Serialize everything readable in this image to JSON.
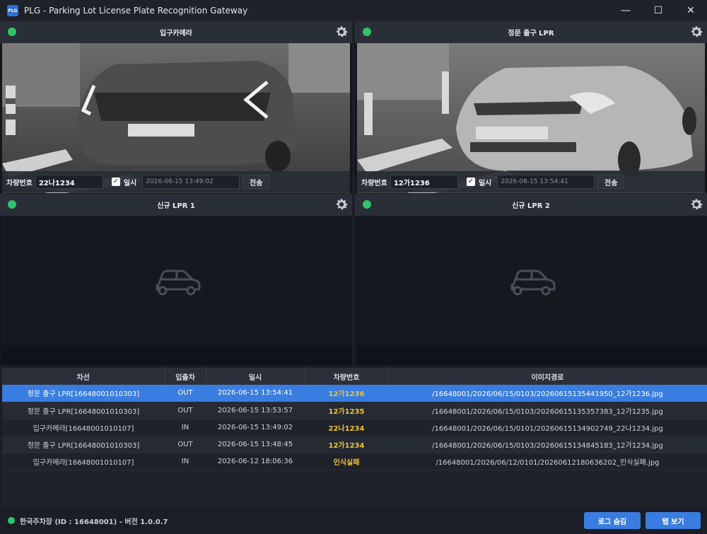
{
  "window": {
    "app_icon": "PLG",
    "title": "PLG - Parking Lot License Plate Recognition Gateway",
    "minimize": "—",
    "maximize": "☐",
    "close": "✕"
  },
  "panels": [
    {
      "title": "입구카메라",
      "status": "online",
      "plate_label": "차량번호",
      "plate": "22나1234",
      "check_label": "일시",
      "datetime": "2026-06-15 13:49:02",
      "send_label": "전송"
    },
    {
      "title": "정문 출구 LPR",
      "status": "online",
      "plate_label": "차량번호",
      "plate": "12가1236",
      "check_label": "일시",
      "datetime": "2026-06-15 13:54:41",
      "send_label": "전송"
    },
    {
      "title": "신규 LPR 1",
      "status": "online"
    },
    {
      "title": "신규 LPR 2",
      "status": "online"
    }
  ],
  "table": {
    "headers": [
      "차선",
      "입출차",
      "일시",
      "차량번호",
      "이미지경로"
    ],
    "rows": [
      [
        "정문 출구 LPR[16648001010303]",
        "OUT",
        "2026-06-15 13:54:41",
        "12가1236",
        "/16648001/2026/06/15/0103/20260615135441950_12가1236.jpg"
      ],
      [
        "정문 출구 LPR[16648001010303]",
        "OUT",
        "2026-06-15 13:53:57",
        "12가1235",
        "/16648001/2026/06/15/0103/20260615135357383_12가1235.jpg"
      ],
      [
        "입구카메라[16648001010107]",
        "IN",
        "2026-06-15 13:49:02",
        "22나1234",
        "/16648001/2026/06/15/0101/20260615134902749_22나1234.jpg"
      ],
      [
        "정문 출구 LPR[16648001010303]",
        "OUT",
        "2026-06-15 13:48:45",
        "12가1234",
        "/16648001/2026/06/15/0103/20260615134845183_12가1234.jpg"
      ],
      [
        "입구카메라[16648001010107]",
        "IN",
        "2026-06-12 18:06:36",
        "인식실패",
        "/16648001/2026/06/12/0101/20260612180636202_인식실패.jpg"
      ]
    ],
    "selected_row": 0
  },
  "statusbar": {
    "text": "한국주차장 (ID : 16648001) - 버전 1.0.0.7",
    "log_hide_label": "로그 숨김",
    "tab_view_label": "탭 보기"
  },
  "colors": {
    "accent": "#3a7de0",
    "online": "#2fc46a",
    "plate_text": "#f2c230"
  },
  "icons": [
    "gear-icon",
    "car-placeholder-icon",
    "checkbox-checked-icon"
  ]
}
